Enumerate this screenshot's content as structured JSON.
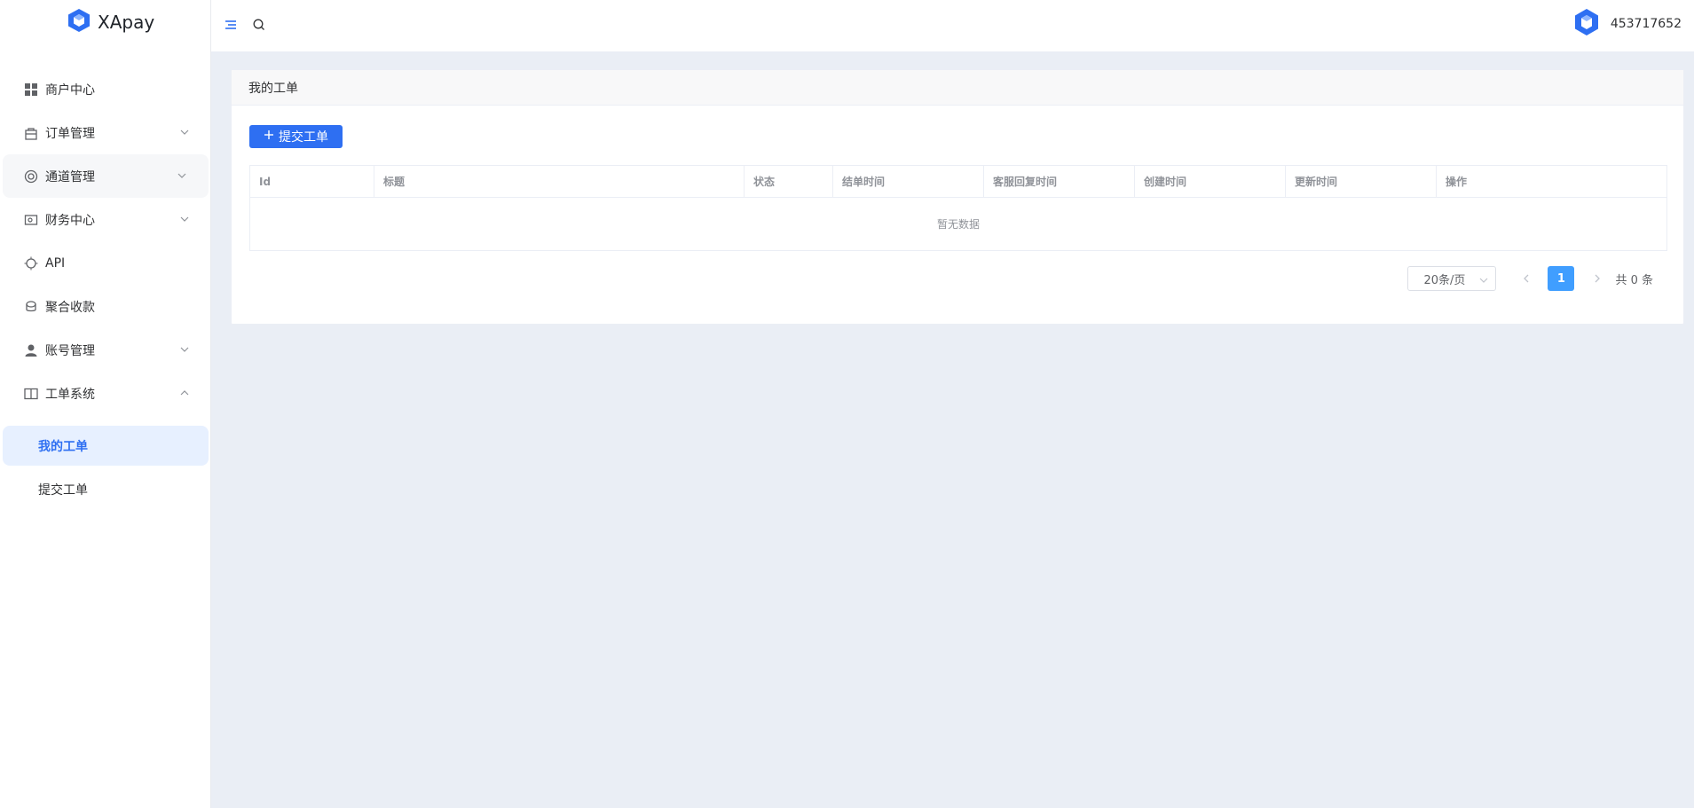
{
  "app": {
    "name": "XApay"
  },
  "header": {
    "username": "453717652"
  },
  "sidebar": {
    "items": [
      {
        "label": "商户中心",
        "icon": "grid-icon",
        "expandable": false
      },
      {
        "label": "订单管理",
        "icon": "bag-icon",
        "expandable": true
      },
      {
        "label": "通道管理",
        "icon": "lifebuoy-icon",
        "expandable": true
      },
      {
        "label": "财务中心",
        "icon": "wallet-icon",
        "expandable": true
      },
      {
        "label": "API",
        "icon": "chip-icon",
        "expandable": false
      },
      {
        "label": "聚合收款",
        "icon": "cash-icon",
        "expandable": false
      },
      {
        "label": "账号管理",
        "icon": "user-icon",
        "expandable": true
      },
      {
        "label": "工单系统",
        "icon": "book-icon",
        "expandable": true,
        "expanded": true
      }
    ],
    "submenu": [
      {
        "label": "我的工单",
        "active": true
      },
      {
        "label": "提交工单",
        "active": false
      }
    ]
  },
  "main": {
    "title": "我的工单",
    "submit_button": "提交工单",
    "table": {
      "columns": [
        "Id",
        "标题",
        "状态",
        "结单时间",
        "客服回复时间",
        "创建时间",
        "更新时间",
        "操作"
      ],
      "empty_text": "暂无数据"
    },
    "pagination": {
      "page_size": "20条/页",
      "current_page": "1",
      "total": "共 0 条"
    }
  },
  "colors": {
    "primary": "#2e6ff2",
    "page_bg": "#eaeef5",
    "pager_active": "#409eff"
  }
}
